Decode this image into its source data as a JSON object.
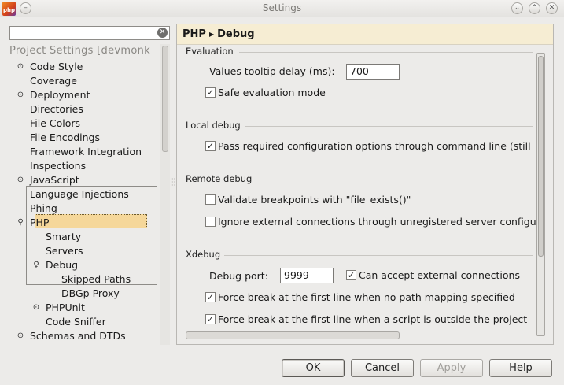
{
  "window": {
    "title": "Settings",
    "app_icon_text": "php"
  },
  "search": {
    "value": ""
  },
  "tree": {
    "header": "Project Settings [devmonk",
    "items": [
      {
        "label": "Code Style",
        "toggle": "⊙"
      },
      {
        "label": "Coverage"
      },
      {
        "label": "Deployment",
        "toggle": "⊙"
      },
      {
        "label": "Directories"
      },
      {
        "label": "File Colors"
      },
      {
        "label": "File Encodings"
      },
      {
        "label": "Framework Integration"
      },
      {
        "label": "Inspections"
      },
      {
        "label": "JavaScript",
        "toggle": "⊙"
      },
      {
        "label": "Language Injections"
      },
      {
        "label": "Phing"
      },
      {
        "label": "PHP",
        "toggle": "♀"
      },
      {
        "label": "Smarty"
      },
      {
        "label": "Servers"
      },
      {
        "label": "Debug",
        "toggle": "♀"
      },
      {
        "label": "Skipped Paths"
      },
      {
        "label": "DBGp Proxy"
      },
      {
        "label": "PHPUnit",
        "toggle": "⊙"
      },
      {
        "label": "Code Sniffer"
      },
      {
        "label": "Schemas and DTDs",
        "toggle": "⊙"
      }
    ]
  },
  "breadcrumb": {
    "parent": "PHP",
    "current": "Debug"
  },
  "evaluation": {
    "title": "Evaluation",
    "tooltip_delay_label": "Values tooltip delay (ms):",
    "tooltip_delay_value": "700",
    "safe_eval_label": "Safe evaluation mode",
    "safe_eval_checked": true
  },
  "local_debug": {
    "title": "Local debug",
    "pass_config_label": "Pass required configuration options through command line (still",
    "pass_config_checked": true
  },
  "remote_debug": {
    "title": "Remote debug",
    "validate_label": "Validate breakpoints with \"file_exists()\"",
    "validate_checked": false,
    "ignore_label": "Ignore external connections through unregistered server configu",
    "ignore_checked": false
  },
  "xdebug": {
    "title": "Xdebug",
    "port_label": "Debug port:",
    "port_value": "9999",
    "external_label": "Can accept external connections",
    "external_checked": true,
    "force_break_mapping_label": "Force break at the first line when no path mapping specified",
    "force_break_mapping_checked": true,
    "force_break_outside_label": "Force break at the first line when a script is outside the project",
    "force_break_outside_checked": true
  },
  "buttons": {
    "ok": "OK",
    "cancel": "Cancel",
    "apply": "Apply",
    "help": "Help"
  },
  "icons": {
    "check_glyph": "✓",
    "breadcrumb_arrow": "▶",
    "clear_glyph": "✕",
    "window_minimize": "⌄",
    "window_maximize": "⌃",
    "window_close": "✕",
    "window_menu": "–"
  }
}
